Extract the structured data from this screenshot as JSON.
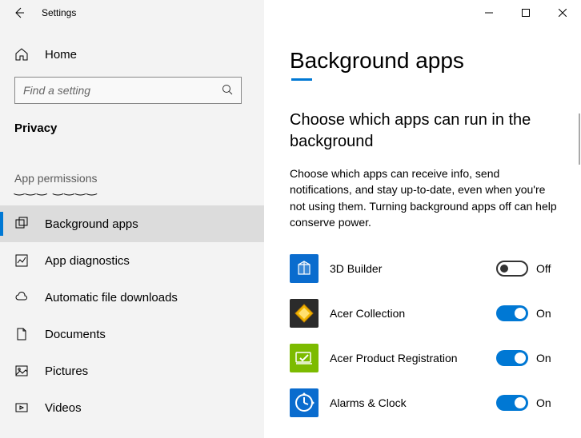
{
  "window": {
    "title": "Settings"
  },
  "sidebar": {
    "home": "Home",
    "search_placeholder": "Find a setting",
    "section": "Privacy",
    "group": "App permissions",
    "items": [
      {
        "label": "Background apps"
      },
      {
        "label": "App diagnostics"
      },
      {
        "label": "Automatic file downloads"
      },
      {
        "label": "Documents"
      },
      {
        "label": "Pictures"
      },
      {
        "label": "Videos"
      }
    ]
  },
  "page": {
    "title": "Background apps",
    "heading": "Choose which apps can run in the background",
    "description": "Choose which apps can receive info, send notifications, and stay up-to-date, even when you're not using them. Turning background apps off can help conserve power."
  },
  "toggle_labels": {
    "on": "On",
    "off": "Off"
  },
  "apps": [
    {
      "name": "3D Builder",
      "state": "off",
      "icon_bg": "#0a6cce"
    },
    {
      "name": "Acer Collection",
      "state": "on",
      "icon_bg": "#2b2b2b"
    },
    {
      "name": "Acer Product Registration",
      "state": "on",
      "icon_bg": "#7cbb00"
    },
    {
      "name": "Alarms & Clock",
      "state": "on",
      "icon_bg": "#0a6cce"
    }
  ]
}
